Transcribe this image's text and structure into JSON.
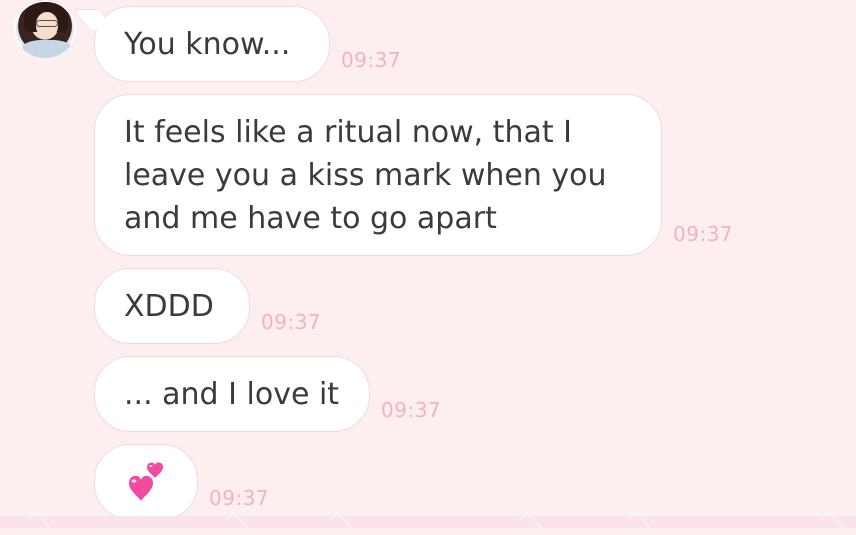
{
  "chat": {
    "messages": [
      {
        "text_lines": [
          "You know..."
        ],
        "time": "09:37"
      },
      {
        "text_lines": [
          "It feels like a ritual now, that I",
          "leave you a kiss mark when you",
          "and me have to go apart"
        ],
        "time": "09:37"
      },
      {
        "text_lines": [
          "XDDD"
        ],
        "time": "09:37"
      },
      {
        "text_lines": [
          "... and I love it"
        ],
        "time": "09:37"
      },
      {
        "emoji": "two-hearts-emoji",
        "time": "09:37"
      }
    ]
  },
  "colors": {
    "background": "#fdeef0",
    "bubble": "#ffffff",
    "bubble_border": "#f1d9de",
    "text": "#3b3b3b",
    "timestamp": "#f3b2c4",
    "heart": "#f24a9c"
  }
}
